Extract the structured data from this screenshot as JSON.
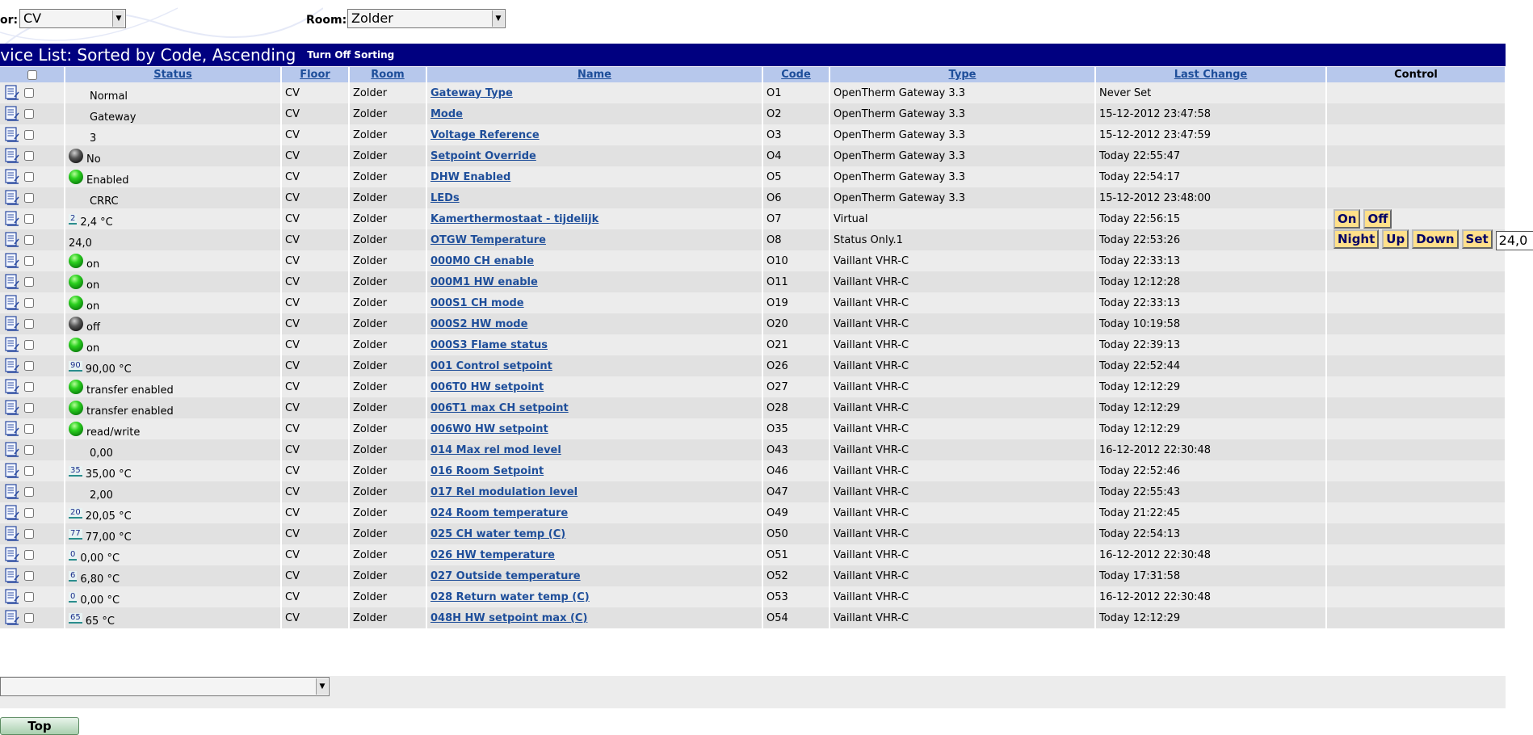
{
  "filters": {
    "floor_label": "or:",
    "floor_value": "CV",
    "room_label": "Room:",
    "room_value": "Zolder"
  },
  "title": {
    "text": "evice List: Sorted by Code, Ascending",
    "sort_link": "Turn Off Sorting"
  },
  "columns": {
    "status": "Status",
    "floor": "Floor",
    "room": "Room",
    "name": "Name",
    "code": "Code",
    "type": "Type",
    "last_change": "Last Change",
    "control": "Control"
  },
  "rows": [
    {
      "status": "Normal",
      "floor": "CV",
      "room": "Zolder",
      "name": "Gateway Type",
      "code": "O1",
      "type": "OpenTherm Gateway 3.3",
      "last_change": "Never Set"
    },
    {
      "status": "Gateway",
      "floor": "CV",
      "room": "Zolder",
      "name": "Mode",
      "code": "O2",
      "type": "OpenTherm Gateway 3.3",
      "last_change": "15-12-2012 23:47:58"
    },
    {
      "status": "3",
      "floor": "CV",
      "room": "Zolder",
      "name": "Voltage Reference",
      "code": "O3",
      "type": "OpenTherm Gateway 3.3",
      "last_change": "15-12-2012 23:47:59"
    },
    {
      "status": "No",
      "led": "off",
      "floor": "CV",
      "room": "Zolder",
      "name": "Setpoint Override",
      "code": "O4",
      "type": "OpenTherm Gateway 3.3",
      "last_change": "Today 22:55:47"
    },
    {
      "status": "Enabled",
      "led": "on",
      "floor": "CV",
      "room": "Zolder",
      "name": "DHW Enabled",
      "code": "O5",
      "type": "OpenTherm Gateway 3.3",
      "last_change": "Today 22:54:17"
    },
    {
      "status": "CRRC",
      "floor": "CV",
      "room": "Zolder",
      "name": "LEDs",
      "code": "O6",
      "type": "OpenTherm Gateway 3.3",
      "last_change": "15-12-2012 23:48:00"
    },
    {
      "status": "2,4 °C",
      "badge": "2",
      "floor": "CV",
      "room": "Zolder",
      "name": "Kamerthermostaat - tijdelijk",
      "code": "O7",
      "type": "Virtual",
      "last_change": "Today 22:56:15",
      "controls": {
        "buttons": [
          "On",
          "Off"
        ]
      }
    },
    {
      "status": "24,0",
      "plain": true,
      "floor": "CV",
      "room": "Zolder",
      "name": "OTGW Temperature",
      "code": "O8",
      "type": "Status Only.1",
      "last_change": "Today 22:53:26",
      "controls": {
        "buttons": [
          "Night",
          "Up",
          "Down",
          "Set"
        ],
        "input": "24,0"
      }
    },
    {
      "status": "on",
      "led": "on",
      "floor": "CV",
      "room": "Zolder",
      "name": "000M0 CH enable",
      "code": "O10",
      "type": "Vaillant VHR-C",
      "last_change": "Today 22:33:13"
    },
    {
      "status": "on",
      "led": "on",
      "floor": "CV",
      "room": "Zolder",
      "name": "000M1 HW enable",
      "code": "O11",
      "type": "Vaillant VHR-C",
      "last_change": "Today 12:12:28"
    },
    {
      "status": "on",
      "led": "on",
      "floor": "CV",
      "room": "Zolder",
      "name": "000S1 CH mode",
      "code": "O19",
      "type": "Vaillant VHR-C",
      "last_change": "Today 22:33:13"
    },
    {
      "status": "off",
      "led": "off",
      "floor": "CV",
      "room": "Zolder",
      "name": "000S2 HW mode",
      "code": "O20",
      "type": "Vaillant VHR-C",
      "last_change": "Today 10:19:58"
    },
    {
      "status": "on",
      "led": "on",
      "floor": "CV",
      "room": "Zolder",
      "name": "000S3 Flame status",
      "code": "O21",
      "type": "Vaillant VHR-C",
      "last_change": "Today 22:39:13"
    },
    {
      "status": "90,00 °C",
      "badge": "90",
      "floor": "CV",
      "room": "Zolder",
      "name": "001 Control setpoint",
      "code": "O26",
      "type": "Vaillant VHR-C",
      "last_change": "Today 22:52:44"
    },
    {
      "status": "transfer enabled",
      "led": "on",
      "floor": "CV",
      "room": "Zolder",
      "name": "006T0 HW setpoint",
      "code": "O27",
      "type": "Vaillant VHR-C",
      "last_change": "Today 12:12:29"
    },
    {
      "status": "transfer enabled",
      "led": "on",
      "floor": "CV",
      "room": "Zolder",
      "name": "006T1 max CH setpoint",
      "code": "O28",
      "type": "Vaillant VHR-C",
      "last_change": "Today 12:12:29"
    },
    {
      "status": "read/write",
      "led": "on",
      "floor": "CV",
      "room": "Zolder",
      "name": "006W0 HW setpoint",
      "code": "O35",
      "type": "Vaillant VHR-C",
      "last_change": "Today 12:12:29"
    },
    {
      "status": "0,00",
      "floor": "CV",
      "room": "Zolder",
      "name": "014 Max rel mod level",
      "code": "O43",
      "type": "Vaillant VHR-C",
      "last_change": "16-12-2012 22:30:48"
    },
    {
      "status": "35,00 °C",
      "badge": "35",
      "floor": "CV",
      "room": "Zolder",
      "name": "016 Room Setpoint",
      "code": "O46",
      "type": "Vaillant VHR-C",
      "last_change": "Today 22:52:46"
    },
    {
      "status": "2,00",
      "floor": "CV",
      "room": "Zolder",
      "name": "017 Rel modulation level",
      "code": "O47",
      "type": "Vaillant VHR-C",
      "last_change": "Today 22:55:43"
    },
    {
      "status": "20,05 °C",
      "badge": "20",
      "floor": "CV",
      "room": "Zolder",
      "name": "024 Room temperature",
      "code": "O49",
      "type": "Vaillant VHR-C",
      "last_change": "Today 21:22:45"
    },
    {
      "status": "77,00 °C",
      "badge": "77",
      "floor": "CV",
      "room": "Zolder",
      "name": "025 CH water temp (C)",
      "code": "O50",
      "type": "Vaillant VHR-C",
      "last_change": "Today 22:54:13"
    },
    {
      "status": "0,00 °C",
      "badge": "0",
      "floor": "CV",
      "room": "Zolder",
      "name": "026 HW temperature",
      "code": "O51",
      "type": "Vaillant VHR-C",
      "last_change": "16-12-2012 22:30:48"
    },
    {
      "status": "6,80 °C",
      "badge": "6",
      "floor": "CV",
      "room": "Zolder",
      "name": "027 Outside temperature",
      "code": "O52",
      "type": "Vaillant VHR-C",
      "last_change": "Today 17:31:58"
    },
    {
      "status": "0,00 °C",
      "badge": "0",
      "floor": "CV",
      "room": "Zolder",
      "name": "028 Return water temp (C)",
      "code": "O53",
      "type": "Vaillant VHR-C",
      "last_change": "16-12-2012 22:30:48"
    },
    {
      "status": "65 °C",
      "badge": "65",
      "floor": "CV",
      "room": "Zolder",
      "name": "048H HW setpoint max (C)",
      "code": "O54",
      "type": "Vaillant VHR-C",
      "last_change": "Today 12:12:29"
    }
  ],
  "footer": {
    "action_select_value": "",
    "top_button": "Top"
  }
}
